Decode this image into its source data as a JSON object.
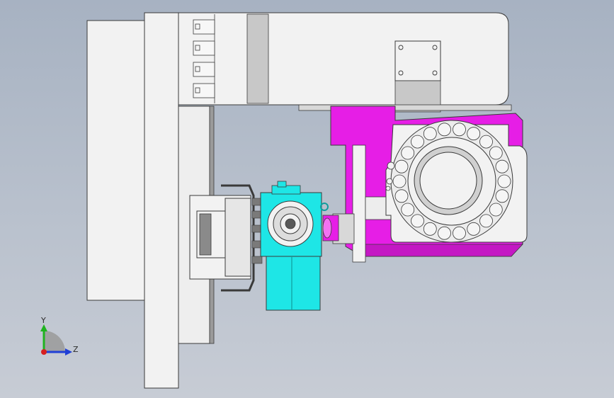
{
  "triad": {
    "y_label": "Y",
    "z_label": "Z",
    "y_color": "#1fb31f",
    "z_color": "#1f3fd6",
    "x_color": "#d61f1f"
  },
  "colors": {
    "frame": "#f2f2f2",
    "frame_edge": "#3a3a3a",
    "gray_part": "#c8c8c8",
    "magenta": "#e61ee6",
    "magenta_dark": "#a814a8",
    "cyan": "#1ee6e6",
    "cyan_dark": "#129c9c",
    "light_part": "#e8e8e8"
  }
}
